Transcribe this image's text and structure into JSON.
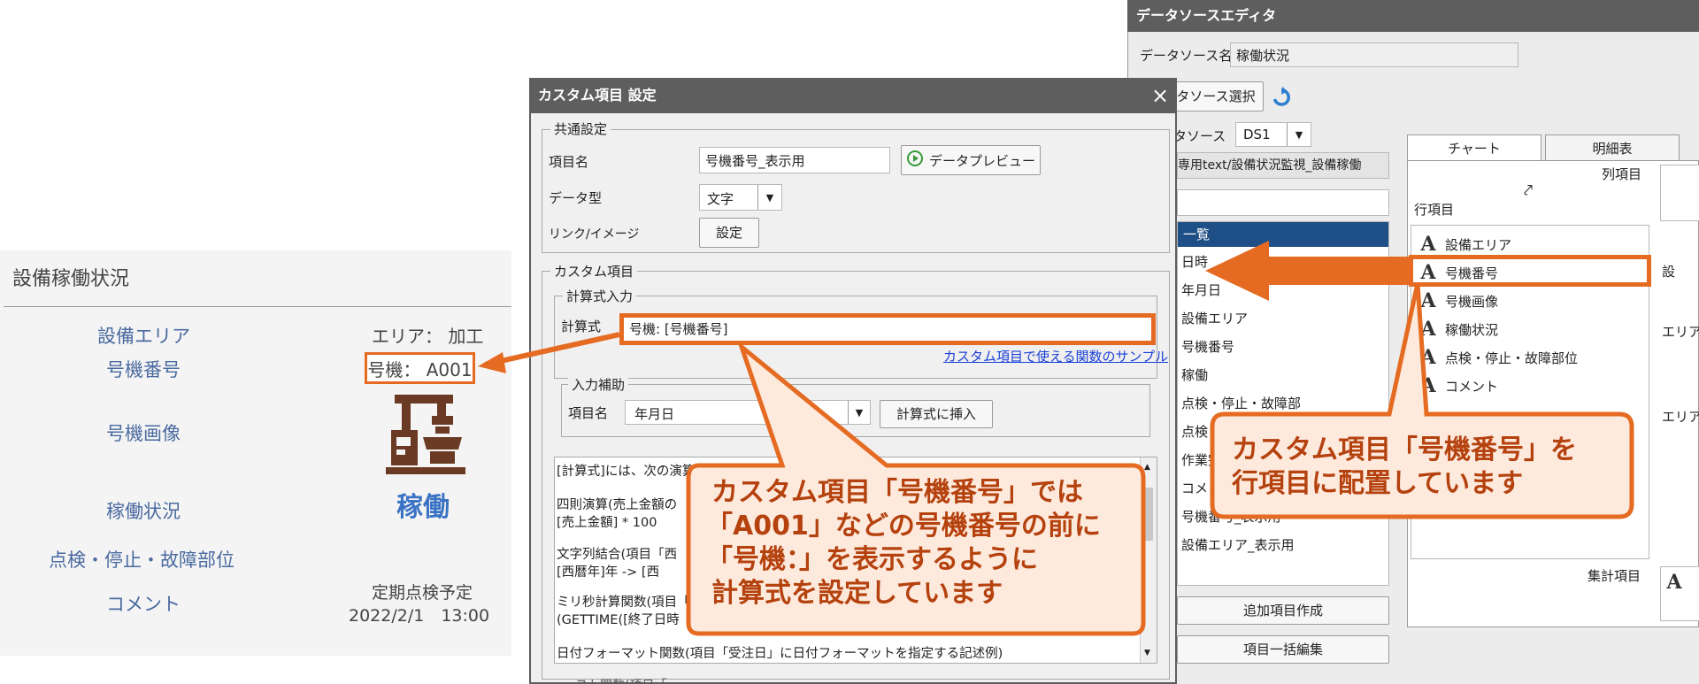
{
  "preview": {
    "title": "設備稼働状況",
    "rows": [
      {
        "label": "設備エリア",
        "value": "エリア： 加工"
      },
      {
        "label": "号機番号",
        "value": "号機： A001"
      },
      {
        "label": "号機画像",
        "value": ""
      },
      {
        "label": "稼働状況",
        "value": "稼働"
      },
      {
        "label": "点検・停止・故障部位",
        "value": ""
      },
      {
        "label": "コメント",
        "value": "定期点検予定"
      }
    ],
    "comment_date": "2022/2/1　13:00"
  },
  "datasource_editor": {
    "title": "データソースエディタ",
    "ds_name_label": "データソース名",
    "ds_name_value": "稼働状況",
    "select_button": "タソース選択",
    "ds_label": "タソース",
    "ds_value": "DS1",
    "path_text": "専用text/設備状況監視_設備稼働",
    "list_header": "一覧",
    "fields": [
      "日時",
      "年月日",
      "設備エリア",
      "号機番号",
      "稼働",
      "点検・停止・故障部",
      "点検・",
      "作業完",
      "コメント",
      "号機番号_表示用",
      "設備エリア_表示用"
    ],
    "add_button": "追加項目作成",
    "bulk_button": "項目一括編集",
    "tabs": [
      "チャート",
      "明細表"
    ],
    "column_label": "列項目",
    "row_label": "行項目",
    "row_items": [
      "設備エリア",
      "号機番号",
      "号機画像",
      "稼働状況",
      "点検・停止・故障部位",
      "コメント"
    ],
    "aggregate_label": "集計項目",
    "right_cut_texts": [
      "設",
      "エリア",
      "エリア"
    ]
  },
  "dialog": {
    "title": "カスタム項目 設定",
    "close": "×",
    "common_group": "共通設定",
    "item_name_label": "項目名",
    "item_name_value": "号機番号_表示用",
    "preview_button": "データプレビュー",
    "data_type_label": "データ型",
    "data_type_value": "文字",
    "link_label": "リンク/イメージ",
    "setting_button": "設定",
    "custom_group": "カスタム項目",
    "formula_group": "計算式入力",
    "formula_label": "計算式",
    "formula_value": "号機: [号機番号]",
    "sample_link": "カスタム項目で使える関数のサンプル",
    "assist_group": "入力補助",
    "assist_item_label": "項目名",
    "assist_item_value": "年月日",
    "insert_button": "計算式に挿入",
    "help_lines": [
      "[計算式]には、次の演算",
      "四則演算(売上金額の",
      " [売上金額] * 100",
      "文字列結合(項目「西",
      " [西暦年]年  ->  [西",
      "ミリ秒計算関数(項目「",
      " (GETTIME([終了日時",
      "日付フォーマット関数(項目「受注日」に日付フォーマットを指定する記述例)"
    ],
    "bottom_cut_text": "ーヌト関数(項目「"
  },
  "callouts": {
    "formula_note": [
      "カスタム項目「号機番号」では",
      "「A001」などの号機番号の前に",
      "「号機：」を表示するように",
      "計算式を設定しています"
    ],
    "row_note": [
      "カスタム項目「号機番号」を",
      "行項目に配置しています"
    ]
  },
  "colors": {
    "accent": "#e56b22",
    "callout_fill": "#fdeadd",
    "title_bar": "#5e5e5e",
    "status_blue": "#3a73c4",
    "label_blue": "#4a6aa0",
    "list_header": "#1e4f86"
  },
  "icons": {
    "machine": "machine-icon",
    "refresh": "refresh-icon",
    "preview": "play-circle-icon",
    "text_field": "text-type-icon"
  }
}
